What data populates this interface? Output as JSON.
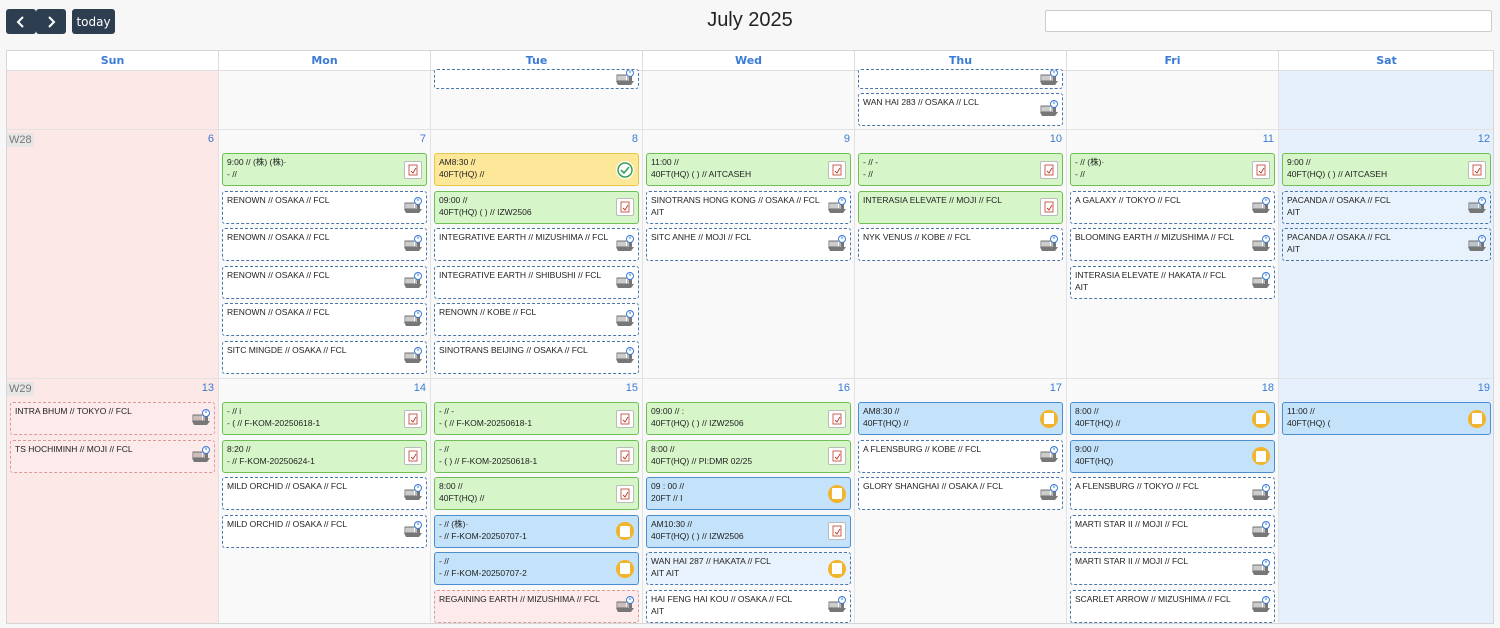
{
  "toolbar": {
    "prev_icon": "chevron-left-icon",
    "next_icon": "chevron-right-icon",
    "today_label": "today",
    "title": "July 2025",
    "search_value": ""
  },
  "days": [
    "Sun",
    "Mon",
    "Tue",
    "Wed",
    "Thu",
    "Fri",
    "Sat"
  ],
  "weeks": [
    {
      "label": "",
      "dates": [
        "",
        "",
        "",
        "",
        "",
        "",
        ""
      ]
    },
    {
      "label": "W28",
      "dates": [
        "6",
        "7",
        "8",
        "9",
        "10",
        "11",
        "12"
      ]
    },
    {
      "label": "W29",
      "dates": [
        "13",
        "14",
        "15",
        "16",
        "17",
        "18",
        "19"
      ]
    }
  ],
  "colors": {
    "header_text": "#3a7bd5",
    "weekend_sun": "#fde8e8",
    "weekend_sat": "#e6f0fd",
    "green_event": "#d6f5c9",
    "yellow_event": "#fde89a",
    "blue_event": "#c4e3fa"
  },
  "events": [
    {
      "w": 0,
      "d": 2,
      "slot": 0,
      "style": "dash",
      "icon": "ship-icon",
      "l1": "",
      "l2": ""
    },
    {
      "w": 0,
      "d": 4,
      "slot": 0,
      "style": "dash",
      "icon": "ship-icon",
      "l1": "",
      "l2": ""
    },
    {
      "w": 0,
      "d": 4,
      "slot": 1,
      "style": "dash",
      "icon": "ship-icon",
      "l1": "WAN HAI 283 // OSAKA // LCL",
      "l2": ""
    },
    {
      "w": 1,
      "d": 1,
      "slot": 0,
      "style": "green",
      "icon": "document-icon",
      "l1": "9:00 // (株)                    (株)·",
      "l2": "- //"
    },
    {
      "w": 1,
      "d": 1,
      "slot": 1,
      "style": "dash",
      "icon": "ship-icon",
      "l1": "RENOWN // OSAKA // FCL",
      "l2": ""
    },
    {
      "w": 1,
      "d": 1,
      "slot": 2,
      "style": "dash",
      "icon": "ship-icon",
      "l1": "RENOWN // OSAKA // FCL",
      "l2": ""
    },
    {
      "w": 1,
      "d": 1,
      "slot": 3,
      "style": "dash",
      "icon": "ship-icon",
      "l1": "RENOWN // OSAKA // FCL",
      "l2": ""
    },
    {
      "w": 1,
      "d": 1,
      "slot": 4,
      "style": "dash",
      "icon": "ship-icon",
      "l1": "RENOWN // OSAKA // FCL",
      "l2": ""
    },
    {
      "w": 1,
      "d": 1,
      "slot": 5,
      "style": "dash",
      "icon": "ship-icon",
      "l1": "SITC MINGDE // OSAKA // FCL",
      "l2": ""
    },
    {
      "w": 1,
      "d": 2,
      "slot": 0,
      "style": "yellow",
      "icon": "check-circle-icon",
      "l1": "AM8:30 //",
      "l2": "40FT(HQ) //"
    },
    {
      "w": 1,
      "d": 2,
      "slot": 1,
      "style": "green",
      "icon": "document-icon",
      "l1": "09:00 //",
      "l2": "40FT(HQ) (                              ) // IZW2506"
    },
    {
      "w": 1,
      "d": 2,
      "slot": 2,
      "style": "dash",
      "icon": "ship-icon",
      "l1": "INTEGRATIVE EARTH // MIZUSHIMA // FCL",
      "l2": ""
    },
    {
      "w": 1,
      "d": 2,
      "slot": 3,
      "style": "dash",
      "icon": "ship-icon",
      "l1": "INTEGRATIVE EARTH // SHIBUSHI // FCL",
      "l2": ""
    },
    {
      "w": 1,
      "d": 2,
      "slot": 4,
      "style": "dash",
      "icon": "ship-icon",
      "l1": "RENOWN // KOBE // FCL",
      "l2": ""
    },
    {
      "w": 1,
      "d": 2,
      "slot": 5,
      "style": "dash",
      "icon": "ship-icon",
      "l1": "SINOTRANS BEIJING // OSAKA // FCL",
      "l2": ""
    },
    {
      "w": 1,
      "d": 3,
      "slot": 0,
      "style": "green",
      "icon": "document-icon",
      "l1": "11:00 //",
      "l2": "40FT(HQ) (                              ) // AITCASEH"
    },
    {
      "w": 1,
      "d": 3,
      "slot": 1,
      "style": "dash",
      "icon": "ship-icon",
      "l1": "SINOTRANS HONG KONG // OSAKA // FCL",
      "l2": "AIT"
    },
    {
      "w": 1,
      "d": 3,
      "slot": 2,
      "style": "dash",
      "icon": "ship-icon",
      "l1": "SITC ANHE // MOJI // FCL",
      "l2": ""
    },
    {
      "w": 1,
      "d": 4,
      "slot": 0,
      "style": "green",
      "icon": "document-icon",
      "l1": "- // -",
      "l2": "- //"
    },
    {
      "w": 1,
      "d": 4,
      "slot": 1,
      "style": "green",
      "icon": "document-icon",
      "l1": "INTERASIA ELEVATE // MOJI // FCL",
      "l2": ""
    },
    {
      "w": 1,
      "d": 4,
      "slot": 2,
      "style": "dash",
      "icon": "ship-icon",
      "l1": "NYK VENUS // KOBE // FCL",
      "l2": ""
    },
    {
      "w": 1,
      "d": 5,
      "slot": 0,
      "style": "green",
      "icon": "document-icon",
      "l1": "- // (株)·",
      "l2": "- //"
    },
    {
      "w": 1,
      "d": 5,
      "slot": 1,
      "style": "dash",
      "icon": "ship-icon",
      "l1": "A GALAXY // TOKYO // FCL",
      "l2": ""
    },
    {
      "w": 1,
      "d": 5,
      "slot": 2,
      "style": "dash",
      "icon": "ship-icon",
      "l1": "BLOOMING EARTH // MIZUSHIMA // FCL",
      "l2": ""
    },
    {
      "w": 1,
      "d": 5,
      "slot": 3,
      "style": "dash",
      "icon": "ship-icon",
      "l1": "INTERASIA ELEVATE // HAKATA // FCL",
      "l2": "AIT"
    },
    {
      "w": 1,
      "d": 6,
      "slot": 0,
      "style": "green",
      "icon": "document-icon",
      "l1": "9:00 //",
      "l2": "40FT(HQ) (                              ) // AITCASEH"
    },
    {
      "w": 1,
      "d": 6,
      "slot": 1,
      "style": "dashblue",
      "icon": "ship-icon",
      "l1": "PACANDA // OSAKA // FCL",
      "l2": "AIT"
    },
    {
      "w": 1,
      "d": 6,
      "slot": 2,
      "style": "dashblue",
      "icon": "ship-icon",
      "l1": "PACANDA // OSAKA // FCL",
      "l2": "AIT"
    },
    {
      "w": 2,
      "d": 0,
      "slot": 0,
      "style": "dashred",
      "icon": "ship-icon",
      "l1": "INTRA BHUM // TOKYO // FCL",
      "l2": ""
    },
    {
      "w": 2,
      "d": 0,
      "slot": 1,
      "style": "dashred",
      "icon": "ship-icon",
      "l1": "TS HOCHIMINH // MOJI // FCL",
      "l2": ""
    },
    {
      "w": 2,
      "d": 1,
      "slot": 0,
      "style": "green",
      "icon": "document-icon",
      "l1": "- // i",
      "l2": "- (                              // F-KOM-20250618-1"
    },
    {
      "w": 2,
      "d": 1,
      "slot": 1,
      "style": "green",
      "icon": "document-icon",
      "l1": "8:20 //",
      "l2": "- // F-KOM-20250624-1"
    },
    {
      "w": 2,
      "d": 1,
      "slot": 2,
      "style": "dash",
      "icon": "ship-icon",
      "l1": "MILD ORCHID // OSAKA // FCL",
      "l2": ""
    },
    {
      "w": 2,
      "d": 1,
      "slot": 3,
      "style": "dash",
      "icon": "ship-icon",
      "l1": "MILD ORCHID // OSAKA // FCL",
      "l2": ""
    },
    {
      "w": 2,
      "d": 2,
      "slot": 0,
      "style": "green",
      "icon": "document-icon",
      "l1": "- // -",
      "l2": "- (                              // F-KOM-20250618-1"
    },
    {
      "w": 2,
      "d": 2,
      "slot": 1,
      "style": "green",
      "icon": "document-icon",
      "l1": "- //",
      "l2": "- (                              ) // F-KOM-20250618-1"
    },
    {
      "w": 2,
      "d": 2,
      "slot": 2,
      "style": "green",
      "icon": "document-icon",
      "l1": "8:00 //",
      "l2": "40FT(HQ) //"
    },
    {
      "w": 2,
      "d": 2,
      "slot": 3,
      "style": "blue",
      "icon": "coin-icon",
      "l1": "- // (株)·",
      "l2": "- // F-KOM-20250707-1"
    },
    {
      "w": 2,
      "d": 2,
      "slot": 4,
      "style": "blue",
      "icon": "coin-icon",
      "l1": "- //",
      "l2": "- // F-KOM-20250707-2"
    },
    {
      "w": 2,
      "d": 2,
      "slot": 5,
      "style": "dashred",
      "icon": "ship-icon",
      "l1": "REGAINING EARTH // MIZUSHIMA // FCL",
      "l2": ""
    },
    {
      "w": 2,
      "d": 3,
      "slot": 0,
      "style": "green",
      "icon": "document-icon",
      "l1": "09:00 // :",
      "l2": "40FT(HQ) (                              ) // IZW2506"
    },
    {
      "w": 2,
      "d": 3,
      "slot": 1,
      "style": "green",
      "icon": "document-icon",
      "l1": "8:00 //",
      "l2": "40FT(HQ) // PI:DMR 02/25"
    },
    {
      "w": 2,
      "d": 3,
      "slot": 2,
      "style": "blue",
      "icon": "coin-icon",
      "l1": "09 : 00 //",
      "l2": "20FT // I"
    },
    {
      "w": 2,
      "d": 3,
      "slot": 3,
      "style": "blue",
      "icon": "document-icon",
      "l1": "AM10:30 //",
      "l2": "40FT(HQ) (                              ) // IZW2506"
    },
    {
      "w": 2,
      "d": 3,
      "slot": 4,
      "style": "dashblue",
      "icon": "coin-icon",
      "l1": "WAN HAI 287 // HAKATA // FCL",
      "l2": "AIT                              AIT"
    },
    {
      "w": 2,
      "d": 3,
      "slot": 5,
      "style": "dash",
      "icon": "ship-icon",
      "l1": "HAI FENG HAI KOU // OSAKA // FCL",
      "l2": "AIT"
    },
    {
      "w": 2,
      "d": 4,
      "slot": 0,
      "style": "blue",
      "icon": "coin-icon",
      "l1": "AM8:30 //",
      "l2": "40FT(HQ) //"
    },
    {
      "w": 2,
      "d": 4,
      "slot": 1,
      "style": "dash",
      "icon": "ship-icon",
      "l1": "A FLENSBURG // KOBE // FCL",
      "l2": ""
    },
    {
      "w": 2,
      "d": 4,
      "slot": 2,
      "style": "dash",
      "icon": "ship-icon",
      "l1": "GLORY SHANGHAI // OSAKA // FCL",
      "l2": ""
    },
    {
      "w": 2,
      "d": 5,
      "slot": 0,
      "style": "blue",
      "icon": "coin-icon",
      "l1": "8:00 //",
      "l2": "40FT(HQ) //"
    },
    {
      "w": 2,
      "d": 5,
      "slot": 1,
      "style": "blue",
      "icon": "coin-icon",
      "l1": "9:00 //",
      "l2": "40FT(HQ)"
    },
    {
      "w": 2,
      "d": 5,
      "slot": 2,
      "style": "dash",
      "icon": "ship-icon",
      "l1": "A FLENSBURG // TOKYO // FCL",
      "l2": ""
    },
    {
      "w": 2,
      "d": 5,
      "slot": 3,
      "style": "dash",
      "icon": "ship-icon",
      "l1": "MARTI STAR II // MOJI // FCL",
      "l2": ""
    },
    {
      "w": 2,
      "d": 5,
      "slot": 4,
      "style": "dash",
      "icon": "ship-icon",
      "l1": "MARTI STAR II // MOJI // FCL",
      "l2": ""
    },
    {
      "w": 2,
      "d": 5,
      "slot": 5,
      "style": "dash",
      "icon": "ship-icon",
      "l1": "SCARLET ARROW // MIZUSHIMA // FCL",
      "l2": ""
    },
    {
      "w": 2,
      "d": 6,
      "slot": 0,
      "style": "blue",
      "icon": "coin-icon",
      "l1": "11:00 //",
      "l2": "40FT(HQ) ("
    }
  ]
}
